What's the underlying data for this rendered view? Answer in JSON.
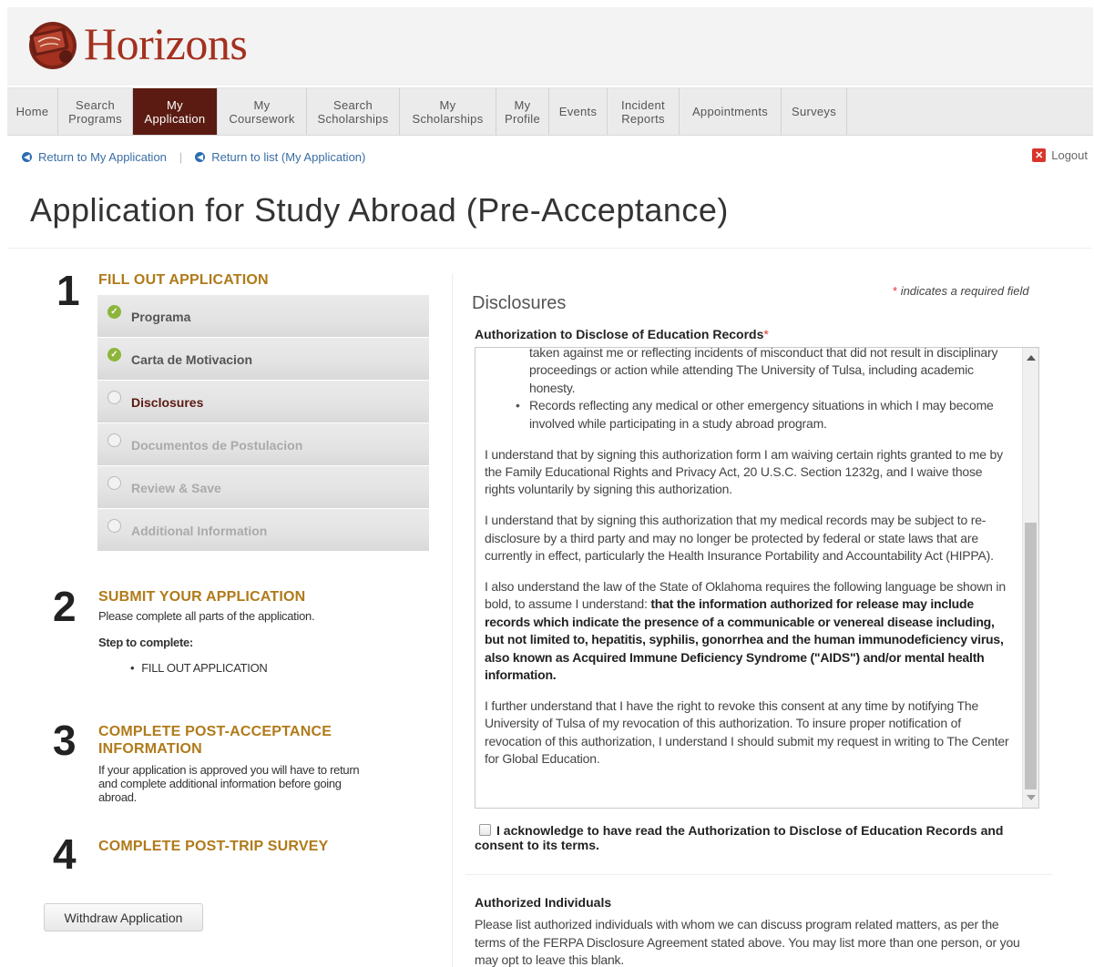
{
  "app": {
    "name": "Horizons"
  },
  "nav": [
    {
      "label": "Home"
    },
    {
      "label": "Search Programs"
    },
    {
      "label": "My Application",
      "active": true
    },
    {
      "label": "My Coursework"
    },
    {
      "label": "Search Scholarships"
    },
    {
      "label": "My Scholarships"
    },
    {
      "label": "My Profile"
    },
    {
      "label": "Events"
    },
    {
      "label": "Incident Reports"
    },
    {
      "label": "Appointments"
    },
    {
      "label": "Surveys"
    }
  ],
  "subnav": {
    "return_app": "Return to My Application",
    "separator": "|",
    "return_list": "Return to list (My Application)",
    "logout": "Logout"
  },
  "page_title": "Application for Study Abroad (Pre-Acceptance)",
  "steps": {
    "s1": {
      "num": "1",
      "heading": "FILL OUT APPLICATION"
    },
    "s2": {
      "num": "2",
      "heading": "SUBMIT YOUR APPLICATION",
      "text": "Please complete all parts of the application.",
      "todo_label": "Step to complete:",
      "todo_item": "FILL OUT APPLICATION"
    },
    "s3": {
      "num": "3",
      "heading_line1": "COMPLETE POST-ACCEPTANCE",
      "heading_line2": "INFORMATION",
      "text": "If your application is approved you will have to return and complete additional information before going abroad."
    },
    "s4": {
      "num": "4",
      "heading": "COMPLETE POST-TRIP SURVEY"
    }
  },
  "app_sections": [
    {
      "label": "Programa",
      "status": "done"
    },
    {
      "label": "Carta de Motivacion",
      "status": "done"
    },
    {
      "label": "Disclosures",
      "status": "current"
    },
    {
      "label": "Documentos de Postulacion",
      "status": "disabled"
    },
    {
      "label": "Review & Save",
      "status": "disabled"
    },
    {
      "label": "Additional Information",
      "status": "disabled"
    }
  ],
  "withdraw_label": "Withdraw Application",
  "form": {
    "required_note": "indicates a required field",
    "required_star": "*",
    "section_title": "Disclosures",
    "auth_label": "Authorization to Disclose of Education Records",
    "scroll": {
      "bullet1_tail": "taken against me or reflecting incidents of misconduct that did not result in disciplinary proceedings or action while attending The University of Tulsa, including academic honesty.",
      "bullet2": "Records reflecting any medical or other emergency situations in which I may become involved while participating in a study abroad program.",
      "p1": "I understand that by signing this authorization form I am waiving certain rights granted to me by the Family Educational Rights and Privacy Act, 20 U.S.C. Section 1232g, and I waive those rights voluntarily by signing this authorization.",
      "p2": "I understand that by signing this authorization that my medical records may be subject to re-disclosure by a third party and may no longer be protected by federal or state laws that are currently in effect, particularly the Health Insurance Portability and Accountability Act (HIPPA).",
      "p3_plain": "I also understand the law of the State of Oklahoma requires the following language be shown in bold, to assume I understand: ",
      "p3_bold": "that the information authorized for release may include records which indicate the presence of a communicable or venereal disease including, but not limited to, hepatitis, syphilis, gonorrhea and the human immunodeficiency virus, also known as Acquired Immune Deficiency Syndrome (\"AIDS\") and/or mental health information.",
      "p4": "I further understand that I have the right to revoke this consent at any time by notifying The University of Tulsa of my revocation of this authorization. To insure proper notification of revocation of this authorization, I understand I should submit my request in writing to The Center for Global Education."
    },
    "ack_label": "I acknowledge to have read the Authorization to Disclose of Education Records and consent to its terms.",
    "authorized_title": "Authorized Individuals",
    "authorized_text": "Please list authorized individuals with whom we can discuss program related matters, as per the terms of the FERPA Disclosure Agreement stated above. You may list more than one person, or you may opt to leave this blank."
  },
  "colors": {
    "brand": "#a4301f",
    "nav_active": "#5b1b12",
    "step_heading": "#b07a1a",
    "link": "#3a6ea5",
    "check": "#8db53b"
  }
}
